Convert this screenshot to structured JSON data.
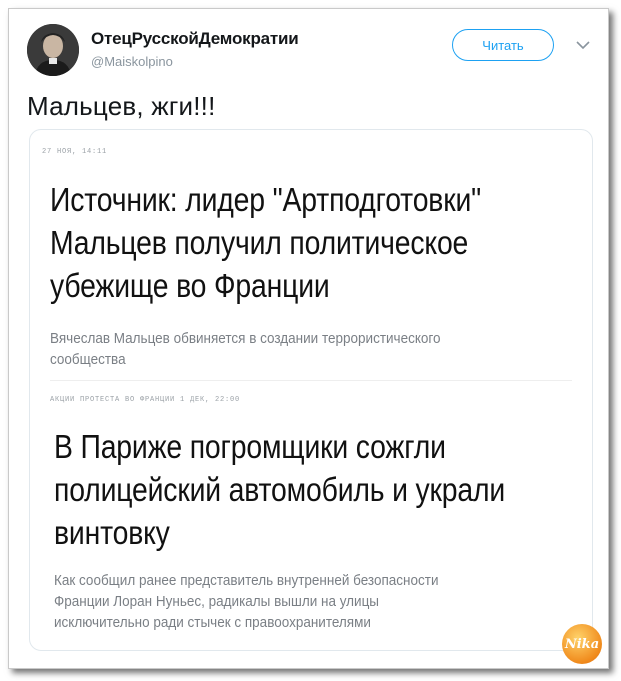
{
  "tweet": {
    "author_name": "ОтецРусскойДемократии",
    "author_handle": "@Maiskolpino",
    "follow_label": "Читать",
    "text": "Мальцев, жги!!!"
  },
  "articles": [
    {
      "meta": "27 НОЯ, 14:11",
      "headline_lines": [
        "Источник: лидер \"Артподготовки\"",
        "Мальцев получил политическое",
        "убежище во Франции"
      ],
      "lead_lines": [
        "Вячеслав Мальцев обвиняется в создании террористического",
        "сообщества"
      ]
    },
    {
      "meta": "АКЦИИ ПРОТЕСТА ВО ФРАНЦИИ   1 ДЕК, 22:00",
      "headline_lines": [
        "В Париже погромщики сожгли",
        "полицейский автомобиль и украли",
        "винтовку"
      ],
      "lead_lines": [
        "Как сообщил ранее представитель внутренней безопасности",
        "Франции Лоран Нуньес, радикалы вышли на улицы",
        "исключительно ради стычек с правоохранителями"
      ]
    }
  ],
  "watermark_text": "Nika",
  "colors": {
    "accent": "#1da1f2",
    "text": "#14171a",
    "muted": "#8a959e"
  }
}
